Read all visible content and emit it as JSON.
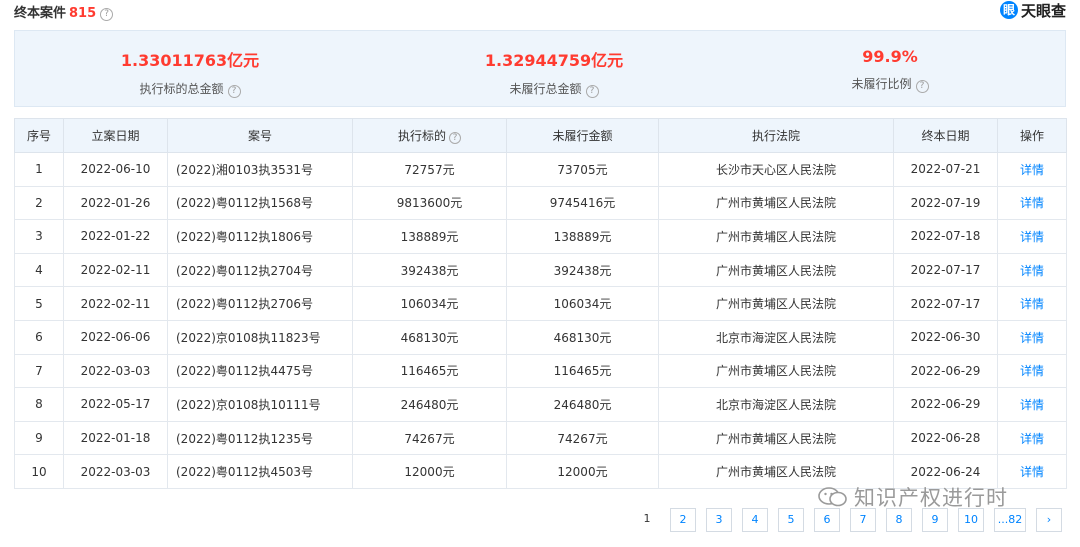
{
  "header": {
    "title": "终本案件",
    "count": "815",
    "help": "?",
    "brand": "天眼查",
    "brand_icon": "眼"
  },
  "summary": [
    {
      "value": "1.33011763亿元",
      "label": "执行标的总金额"
    },
    {
      "value": "1.32944759亿元",
      "label": "未履行总金额"
    },
    {
      "value": "99.9%",
      "label": "未履行比例"
    }
  ],
  "table": {
    "columns": [
      "序号",
      "立案日期",
      "案号",
      "执行标的",
      "未履行金额",
      "执行法院",
      "终本日期",
      "操作"
    ],
    "rows": [
      {
        "no": "1",
        "filed": "2022-06-10",
        "case": "(2022)湘0103执3531号",
        "target": "72757元",
        "unpaid": "73705元",
        "court": "长沙市天心区人民法院",
        "ended": "2022-07-21",
        "action": "详情"
      },
      {
        "no": "2",
        "filed": "2022-01-26",
        "case": "(2022)粤0112执1568号",
        "target": "9813600元",
        "unpaid": "9745416元",
        "court": "广州市黄埔区人民法院",
        "ended": "2022-07-19",
        "action": "详情"
      },
      {
        "no": "3",
        "filed": "2022-01-22",
        "case": "(2022)粤0112执1806号",
        "target": "138889元",
        "unpaid": "138889元",
        "court": "广州市黄埔区人民法院",
        "ended": "2022-07-18",
        "action": "详情"
      },
      {
        "no": "4",
        "filed": "2022-02-11",
        "case": "(2022)粤0112执2704号",
        "target": "392438元",
        "unpaid": "392438元",
        "court": "广州市黄埔区人民法院",
        "ended": "2022-07-17",
        "action": "详情"
      },
      {
        "no": "5",
        "filed": "2022-02-11",
        "case": "(2022)粤0112执2706号",
        "target": "106034元",
        "unpaid": "106034元",
        "court": "广州市黄埔区人民法院",
        "ended": "2022-07-17",
        "action": "详情"
      },
      {
        "no": "6",
        "filed": "2022-06-06",
        "case": "(2022)京0108执11823号",
        "target": "468130元",
        "unpaid": "468130元",
        "court": "北京市海淀区人民法院",
        "ended": "2022-06-30",
        "action": "详情"
      },
      {
        "no": "7",
        "filed": "2022-03-03",
        "case": "(2022)粤0112执4475号",
        "target": "116465元",
        "unpaid": "116465元",
        "court": "广州市黄埔区人民法院",
        "ended": "2022-06-29",
        "action": "详情"
      },
      {
        "no": "8",
        "filed": "2022-05-17",
        "case": "(2022)京0108执10111号",
        "target": "246480元",
        "unpaid": "246480元",
        "court": "北京市海淀区人民法院",
        "ended": "2022-06-29",
        "action": "详情"
      },
      {
        "no": "9",
        "filed": "2022-01-18",
        "case": "(2022)粤0112执1235号",
        "target": "74267元",
        "unpaid": "74267元",
        "court": "广州市黄埔区人民法院",
        "ended": "2022-06-28",
        "action": "详情"
      },
      {
        "no": "10",
        "filed": "2022-03-03",
        "case": "(2022)粤0112执4503号",
        "target": "12000元",
        "unpaid": "12000元",
        "court": "广州市黄埔区人民法院",
        "ended": "2022-06-24",
        "action": "详情"
      }
    ]
  },
  "pagination": {
    "current": "1",
    "pages": [
      "2",
      "3",
      "4",
      "5",
      "6",
      "7",
      "8",
      "9",
      "10",
      "...82"
    ],
    "next": "›"
  },
  "watermark": {
    "text": "知识产权进行时"
  },
  "colors": {
    "accent_red": "#ff3b30",
    "link_blue": "#0084ff",
    "summary_bg": "#eef5fc"
  }
}
